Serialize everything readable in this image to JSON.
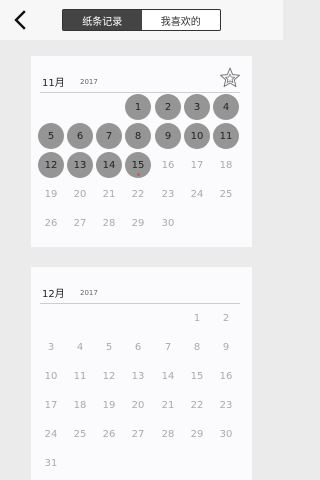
{
  "header": {
    "back_icon": "chevron-left-icon",
    "tabs": [
      {
        "label": "纸条记录",
        "active": true
      },
      {
        "label": "我喜欢的",
        "active": false
      }
    ]
  },
  "months": [
    {
      "month": "11月",
      "year": "2017",
      "favorite_icon": "star-outline-icon",
      "weeks": [
        [
          null,
          null,
          null,
          {
            "n": "1",
            "f": true
          },
          {
            "n": "2",
            "f": true
          },
          {
            "n": "3",
            "f": true
          },
          {
            "n": "4",
            "f": true
          }
        ],
        [
          {
            "n": "5",
            "f": true
          },
          {
            "n": "6",
            "f": true
          },
          {
            "n": "7",
            "f": true
          },
          {
            "n": "8",
            "f": true
          },
          {
            "n": "9",
            "f": true
          },
          {
            "n": "10",
            "f": true
          },
          {
            "n": "11",
            "f": true
          }
        ],
        [
          {
            "n": "12",
            "f": true
          },
          {
            "n": "13",
            "f": true
          },
          {
            "n": "14",
            "f": true
          },
          {
            "n": "15",
            "f": true,
            "today": true
          },
          {
            "n": "16"
          },
          {
            "n": "17"
          },
          {
            "n": "18"
          }
        ],
        [
          {
            "n": "19"
          },
          {
            "n": "20"
          },
          {
            "n": "21"
          },
          {
            "n": "22"
          },
          {
            "n": "23"
          },
          {
            "n": "24"
          },
          {
            "n": "25"
          }
        ],
        [
          {
            "n": "26"
          },
          {
            "n": "27"
          },
          {
            "n": "28"
          },
          {
            "n": "29"
          },
          {
            "n": "30"
          },
          null,
          null
        ]
      ]
    },
    {
      "month": "12月",
      "year": "2017",
      "favorite_icon": null,
      "weeks": [
        [
          null,
          null,
          null,
          null,
          null,
          {
            "n": "1"
          },
          {
            "n": "2"
          }
        ],
        [
          {
            "n": "3"
          },
          {
            "n": "4"
          },
          {
            "n": "5"
          },
          {
            "n": "6"
          },
          {
            "n": "7"
          },
          {
            "n": "8"
          },
          {
            "n": "9"
          }
        ],
        [
          {
            "n": "10"
          },
          {
            "n": "11"
          },
          {
            "n": "12"
          },
          {
            "n": "13"
          },
          {
            "n": "14"
          },
          {
            "n": "15"
          },
          {
            "n": "16"
          }
        ],
        [
          {
            "n": "17"
          },
          {
            "n": "18"
          },
          {
            "n": "19"
          },
          {
            "n": "20"
          },
          {
            "n": "21"
          },
          {
            "n": "22"
          },
          {
            "n": "23"
          }
        ],
        [
          {
            "n": "24"
          },
          {
            "n": "25"
          },
          {
            "n": "26"
          },
          {
            "n": "27"
          },
          {
            "n": "28"
          },
          {
            "n": "29"
          },
          {
            "n": "30"
          }
        ],
        [
          {
            "n": "31"
          },
          null,
          null,
          null,
          null,
          null,
          null
        ]
      ]
    }
  ]
}
